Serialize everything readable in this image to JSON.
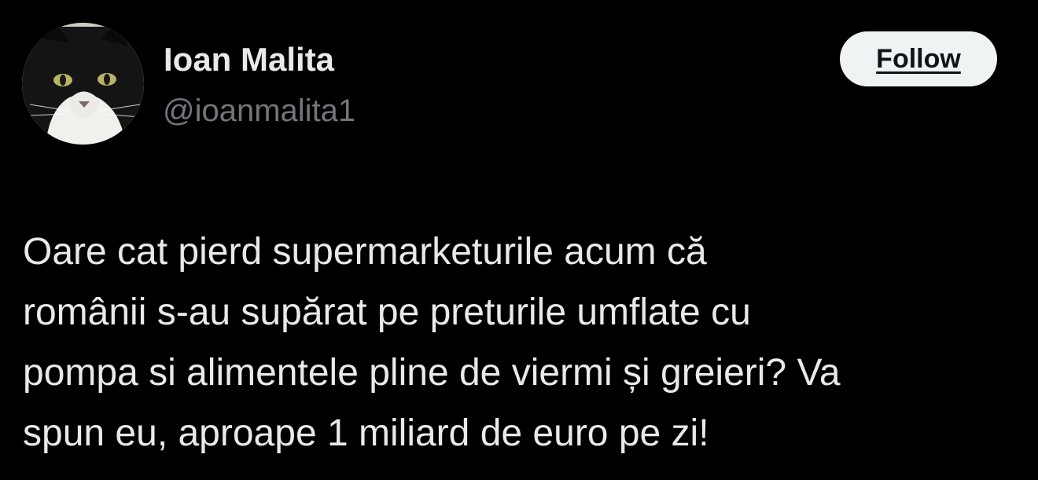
{
  "author": {
    "display_name": "Ioan Malita",
    "handle": "@ioanmalita1",
    "avatar_icon": "cat-avatar"
  },
  "follow_button": {
    "label": "Follow"
  },
  "tweet": {
    "lines": [
      "Oare cat pierd supermarketurile acum că",
      "românii s-au supărat pe preturile umflate cu",
      "pompa si alimentele pline de viermi și greieri? Va",
      "spun eu, aproape 1 miliard de euro pe zi!"
    ]
  },
  "colors": {
    "background": "#000000",
    "text_primary": "#e7e9ea",
    "text_secondary": "#71767b",
    "button_bg": "#eff3f4",
    "button_text": "#0f1419"
  }
}
